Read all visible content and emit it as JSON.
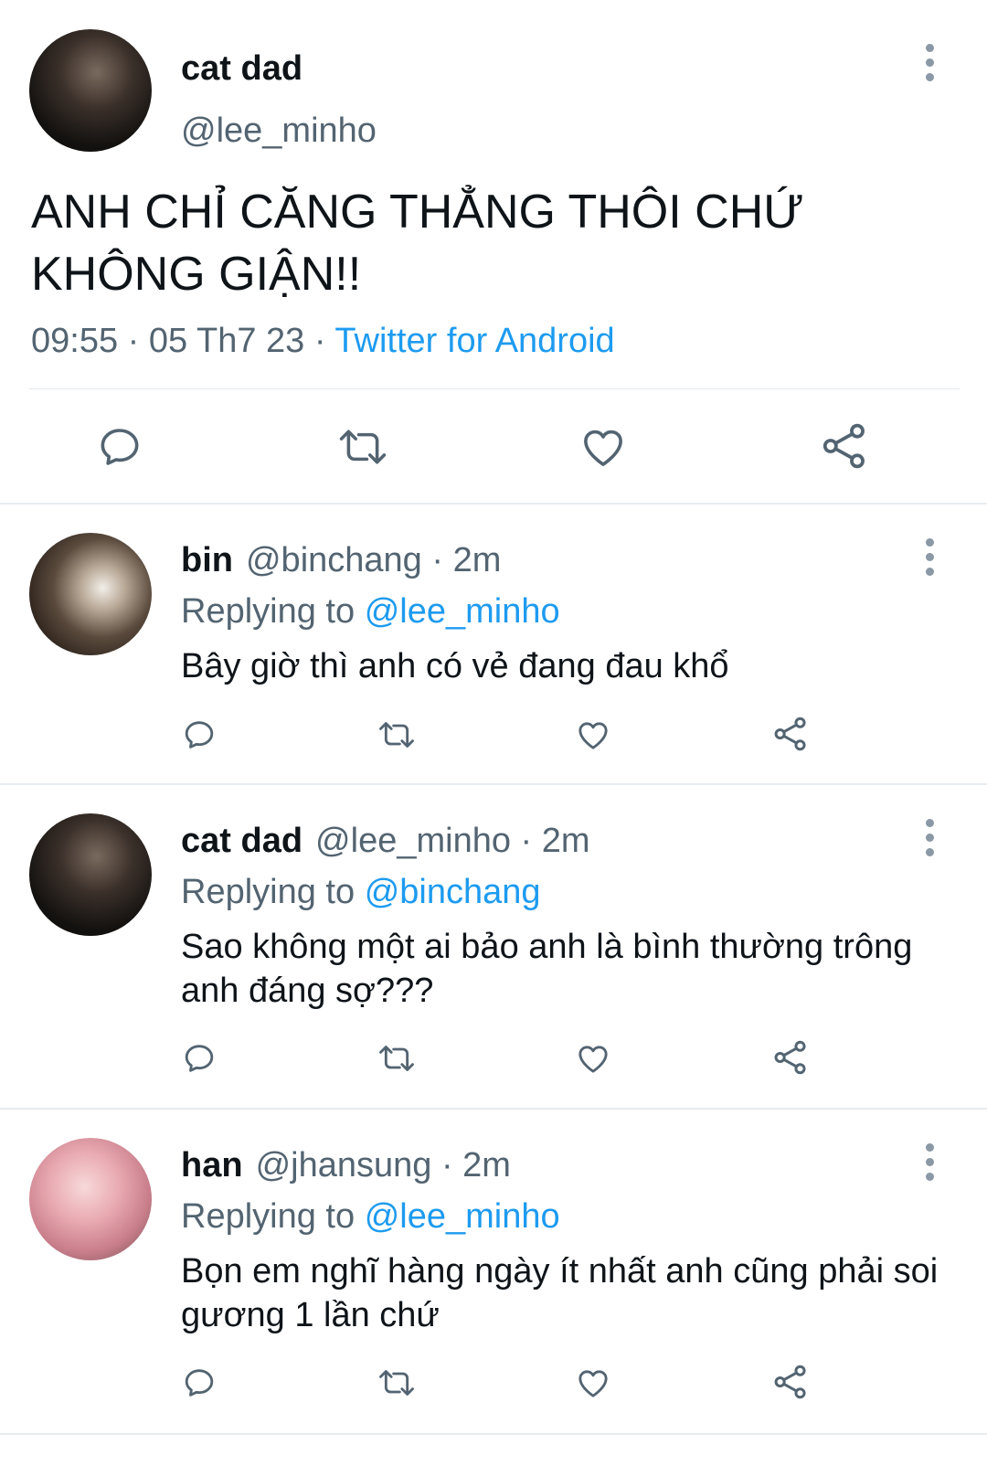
{
  "main_tweet": {
    "display_name": "cat dad",
    "handle": "@lee_minho",
    "text": "ANH CHỈ CĂNG THẲNG THÔI CHỨ KHÔNG GIẬN!!",
    "time": "09:55",
    "date": "05 Th7 23",
    "dot": "·",
    "source": "Twitter for Android"
  },
  "replies": [
    {
      "display_name": "bin",
      "handle": "@binchang",
      "age": "· 2m",
      "replying_label": "Replying to",
      "replying_to": "@lee_minho",
      "text": "Bây giờ thì anh có vẻ đang đau khổ"
    },
    {
      "display_name": "cat dad",
      "handle": "@lee_minho",
      "age": "· 2m",
      "replying_label": "Replying to",
      "replying_to": "@binchang",
      "text": "Sao không một ai bảo anh là bình thường trông anh đáng sợ???"
    },
    {
      "display_name": "han",
      "handle": "@jhansung",
      "age": "· 2m",
      "replying_label": "Replying to",
      "replying_to": "@lee_minho",
      "text": "Bọn em nghĩ hàng ngày ít nhất anh cũng phải soi gương 1 lần chứ"
    }
  ],
  "icons": {
    "reply": "reply-icon",
    "retweet": "retweet-icon",
    "like": "heart-icon",
    "share": "share-icon",
    "more": "more-vertical-icon"
  },
  "colors": {
    "link": "#1d9bf0",
    "secondary_text": "#536471",
    "primary_text": "#0f1419"
  }
}
